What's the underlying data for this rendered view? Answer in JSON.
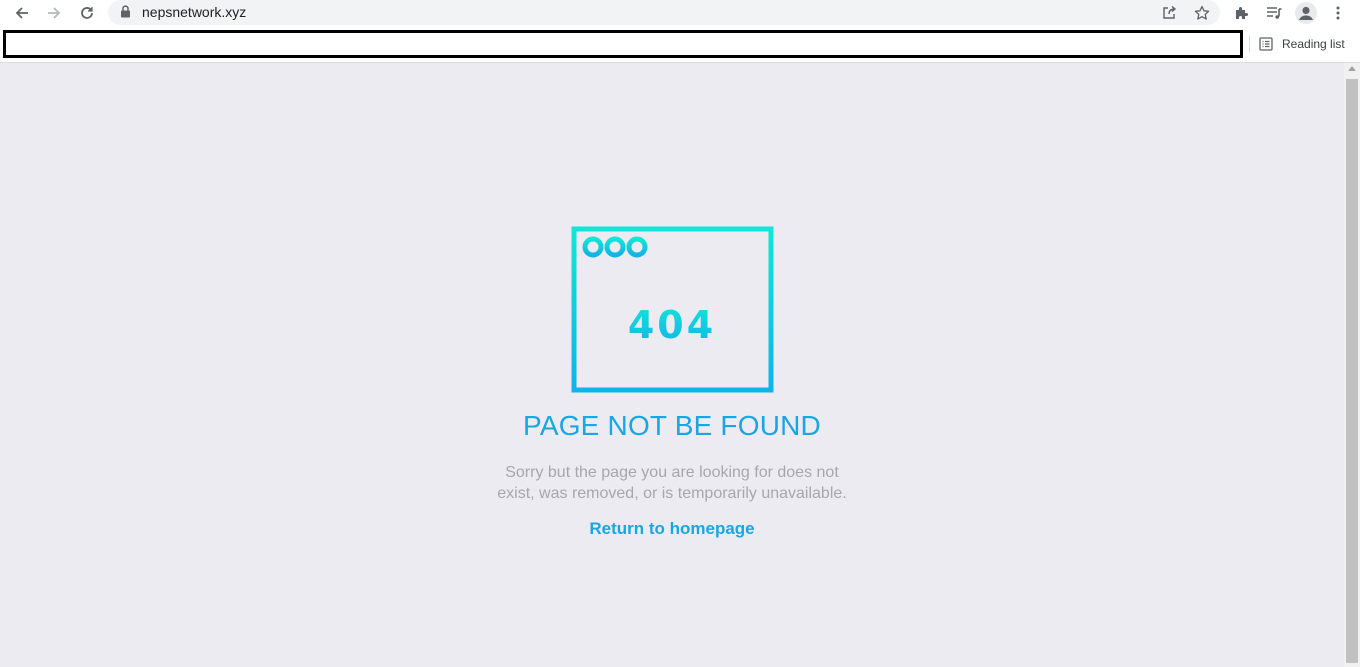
{
  "browser": {
    "url": "nepsnetwork.xyz",
    "icons": {
      "back": "arrow-left-icon",
      "forward": "arrow-right-icon",
      "reload": "reload-icon",
      "lock": "lock-icon",
      "share": "share-icon",
      "bookmark": "star-icon",
      "extensions": "puzzle-icon",
      "media": "media-control-icon",
      "profile": "avatar-icon",
      "menu": "kebab-menu-icon"
    }
  },
  "bookmarks_bar": {
    "reading_list_label": "Reading list"
  },
  "page": {
    "illustration_code": "404",
    "title": "PAGE NOT BE FOUND",
    "message_line1": "Sorry but the page you are looking for does not",
    "message_line2": "exist, was removed, or is temporarily unavailable.",
    "link_label": "Return to homepage"
  },
  "colors": {
    "accent": "#1aa6e0",
    "gradient_top": "#12e6d6",
    "gradient_bottom": "#11b3e8",
    "background": "#ecebf2",
    "muted_text": "#a7a6ad"
  }
}
